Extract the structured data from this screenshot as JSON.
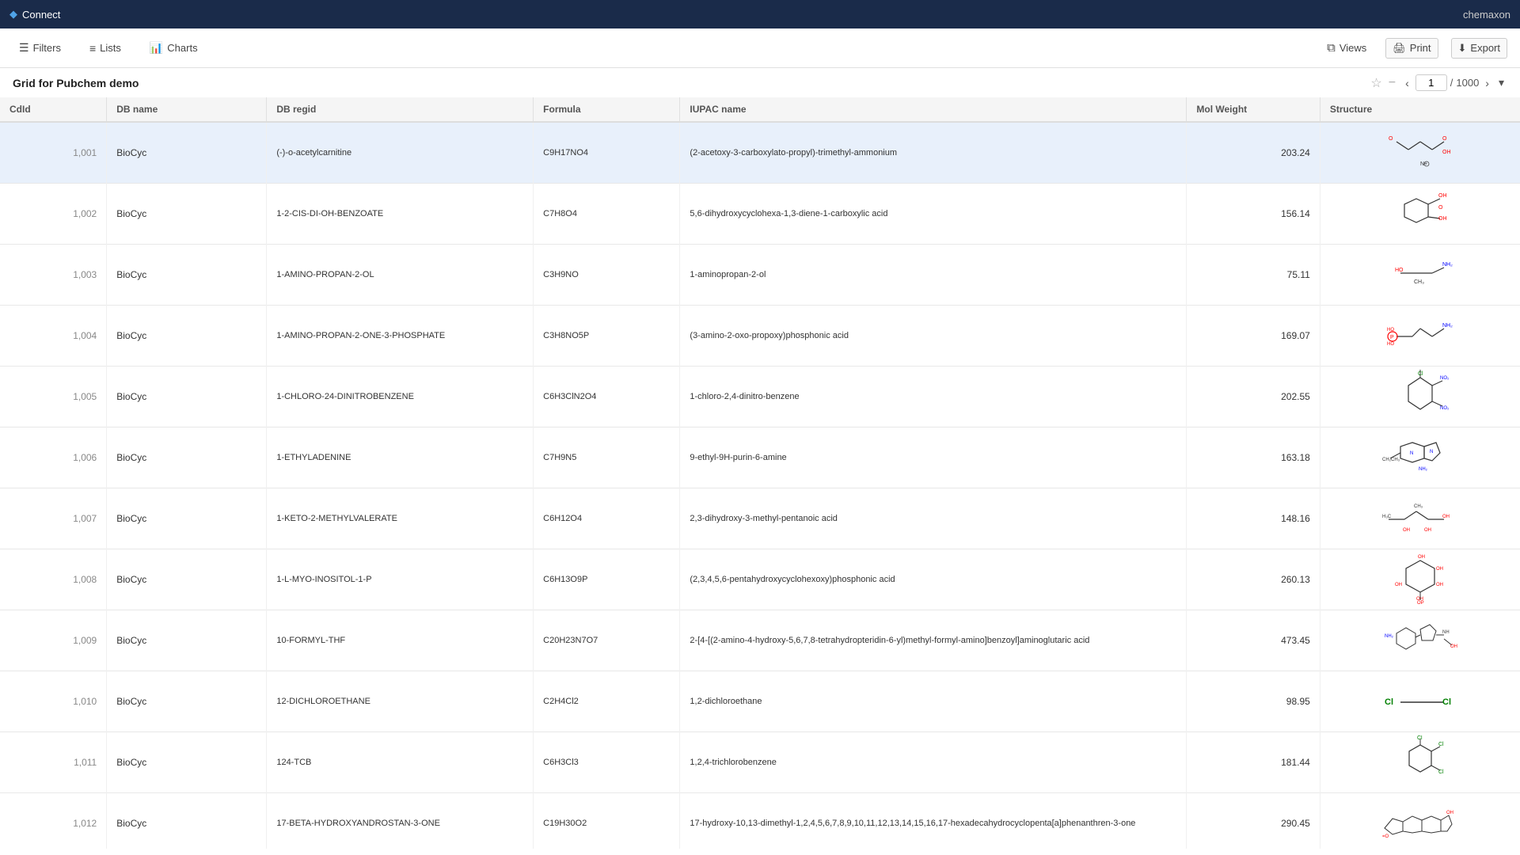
{
  "topbar": {
    "app_name": "Connect",
    "user": "chemaxon"
  },
  "toolbar": {
    "filters_label": "Filters",
    "lists_label": "Lists",
    "charts_label": "Charts",
    "views_label": "Views",
    "print_label": "Print",
    "export_label": "Export"
  },
  "page_title": "Grid for Pubchem demo",
  "pagination": {
    "current_page": "1",
    "total_pages": "1000",
    "separator": "/"
  },
  "table": {
    "columns": [
      "CdId",
      "DB name",
      "DB regid",
      "Formula",
      "IUPAC name",
      "Mol Weight",
      "Structure"
    ],
    "rows": [
      {
        "cdid": "1,001",
        "dbname": "BioCyc",
        "dbregid": "(-)-o-acetylcarnitine",
        "formula": "C9H17NO4",
        "iupac": "(2-acetoxy-3-carboxylato-propyl)-trimethyl-ammonium",
        "molweight": "203.24",
        "mol_type": "acetylcarnitine"
      },
      {
        "cdid": "1,002",
        "dbname": "BioCyc",
        "dbregid": "1-2-CIS-DI-OH-BENZOATE",
        "formula": "C7H8O4",
        "iupac": "5,6-dihydroxycyclohexa-1,3-diene-1-carboxylic acid",
        "molweight": "156.14",
        "mol_type": "benzoate"
      },
      {
        "cdid": "1,003",
        "dbname": "BioCyc",
        "dbregid": "1-AMINO-PROPAN-2-OL",
        "formula": "C3H9NO",
        "iupac": "1-aminopropan-2-ol",
        "molweight": "75.11",
        "mol_type": "aminopropanol"
      },
      {
        "cdid": "1,004",
        "dbname": "BioCyc",
        "dbregid": "1-AMINO-PROPAN-2-ONE-3-PHOSPHATE",
        "formula": "C3H8NO5P",
        "iupac": "(3-amino-2-oxo-propoxy)phosphonic acid",
        "molweight": "169.07",
        "mol_type": "phosphate"
      },
      {
        "cdid": "1,005",
        "dbname": "BioCyc",
        "dbregid": "1-CHLORO-24-DINITROBENZENE",
        "formula": "C6H3ClN2O4",
        "iupac": "1-chloro-2,4-dinitro-benzene",
        "molweight": "202.55",
        "mol_type": "chlorodinitrobenzene"
      },
      {
        "cdid": "1,006",
        "dbname": "BioCyc",
        "dbregid": "1-ETHYLADENINE",
        "formula": "C7H9N5",
        "iupac": "9-ethyl-9H-purin-6-amine",
        "molweight": "163.18",
        "mol_type": "purine"
      },
      {
        "cdid": "1,007",
        "dbname": "BioCyc",
        "dbregid": "1-KETO-2-METHYLVALERATE",
        "formula": "C6H12O4",
        "iupac": "2,3-dihydroxy-3-methyl-pentanoic acid",
        "molweight": "148.16",
        "mol_type": "valerate"
      },
      {
        "cdid": "1,008",
        "dbname": "BioCyc",
        "dbregid": "1-L-MYO-INOSITOL-1-P",
        "formula": "C6H13O9P",
        "iupac": "(2,3,4,5,6-pentahydroxycyclohexoxy)phosphonic acid",
        "molweight": "260.13",
        "mol_type": "inositol"
      },
      {
        "cdid": "1,009",
        "dbname": "BioCyc",
        "dbregid": "10-FORMYL-THF",
        "formula": "C20H23N7O7",
        "iupac": "2-[4-[(2-amino-4-hydroxy-5,6,7,8-tetrahydropteridin-6-yl)methyl-formyl-amino]benzoyl]aminoglutaric acid",
        "molweight": "473.45",
        "mol_type": "thf"
      },
      {
        "cdid": "1,010",
        "dbname": "BioCyc",
        "dbregid": "12-DICHLOROETHANE",
        "formula": "C2H4Cl2",
        "iupac": "1,2-dichloroethane",
        "molweight": "98.95",
        "mol_type": "dichloroethane"
      },
      {
        "cdid": "1,011",
        "dbname": "BioCyc",
        "dbregid": "124-TCB",
        "formula": "C6H3Cl3",
        "iupac": "1,2,4-trichlorobenzene",
        "molweight": "181.44",
        "mol_type": "trichlorobenzene"
      },
      {
        "cdid": "1,012",
        "dbname": "BioCyc",
        "dbregid": "17-BETA-HYDROXYANDROSTAN-3-ONE",
        "formula": "C19H30O2",
        "iupac": "17-hydroxy-10,13-dimethyl-1,2,4,5,6,7,8,9,10,11,12,13,14,15,16,17-hexadecahydrocyclopenta[a]phenanthren-3-one",
        "molweight": "290.45",
        "mol_type": "steroid"
      }
    ]
  }
}
